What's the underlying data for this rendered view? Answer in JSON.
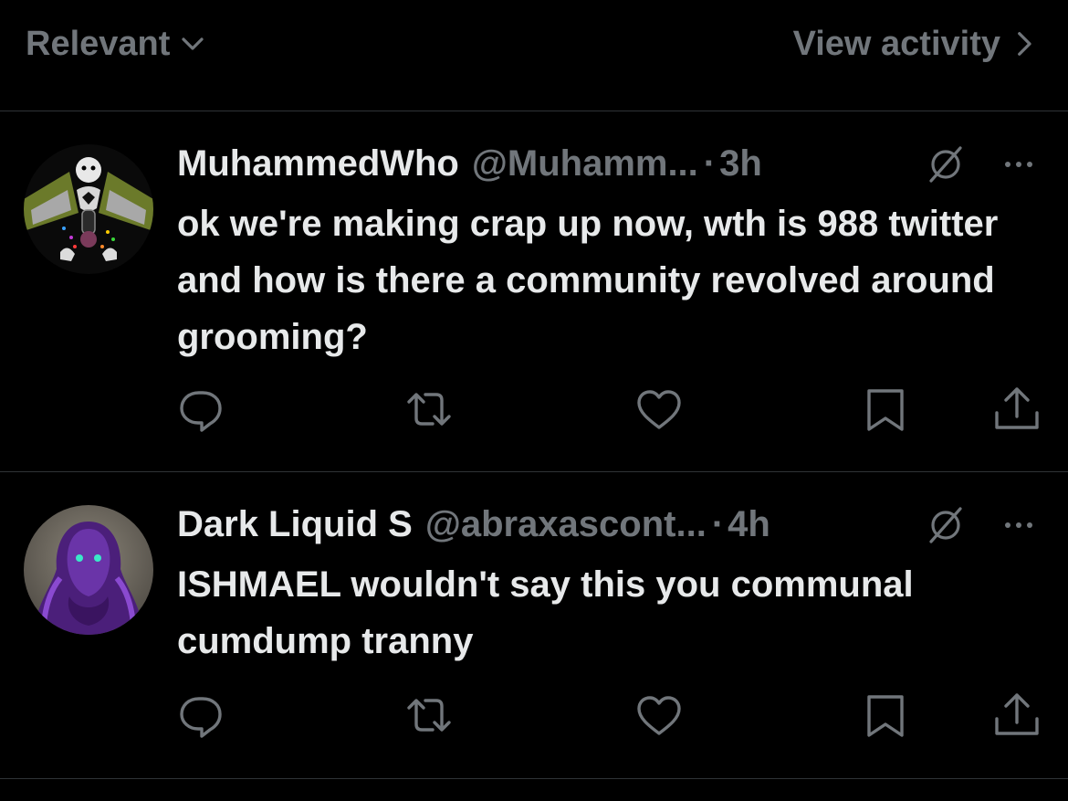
{
  "topbar": {
    "sort_label": "Relevant",
    "activity_label": "View activity"
  },
  "replies": [
    {
      "display_name": "MuhammedWho",
      "handle": "@Muhamm...",
      "dot": "·",
      "time": "3h",
      "text": "ok we're making crap up now, wth is 988 twitter and how is there a community revolved around grooming?",
      "avatar_icon": "avatar-image",
      "icons": [
        "grok-icon",
        "more-icon",
        "reply-icon",
        "retweet-icon",
        "like-icon",
        "bookmark-icon",
        "share-icon"
      ]
    },
    {
      "display_name": "Dark Liquid S",
      "handle": "@abraxascont...",
      "dot": "·",
      "time": "4h",
      "text": "ISHMAEL wouldn't say this you communal cumdump tranny",
      "avatar_icon": "avatar-image",
      "icons": [
        "grok-icon",
        "more-icon",
        "reply-icon",
        "retweet-icon",
        "like-icon",
        "bookmark-icon",
        "share-icon"
      ]
    }
  ],
  "colors": {
    "background": "#000000",
    "primary_text": "#e7e9ea",
    "secondary_text": "#71767b",
    "divider": "#2f3336"
  }
}
